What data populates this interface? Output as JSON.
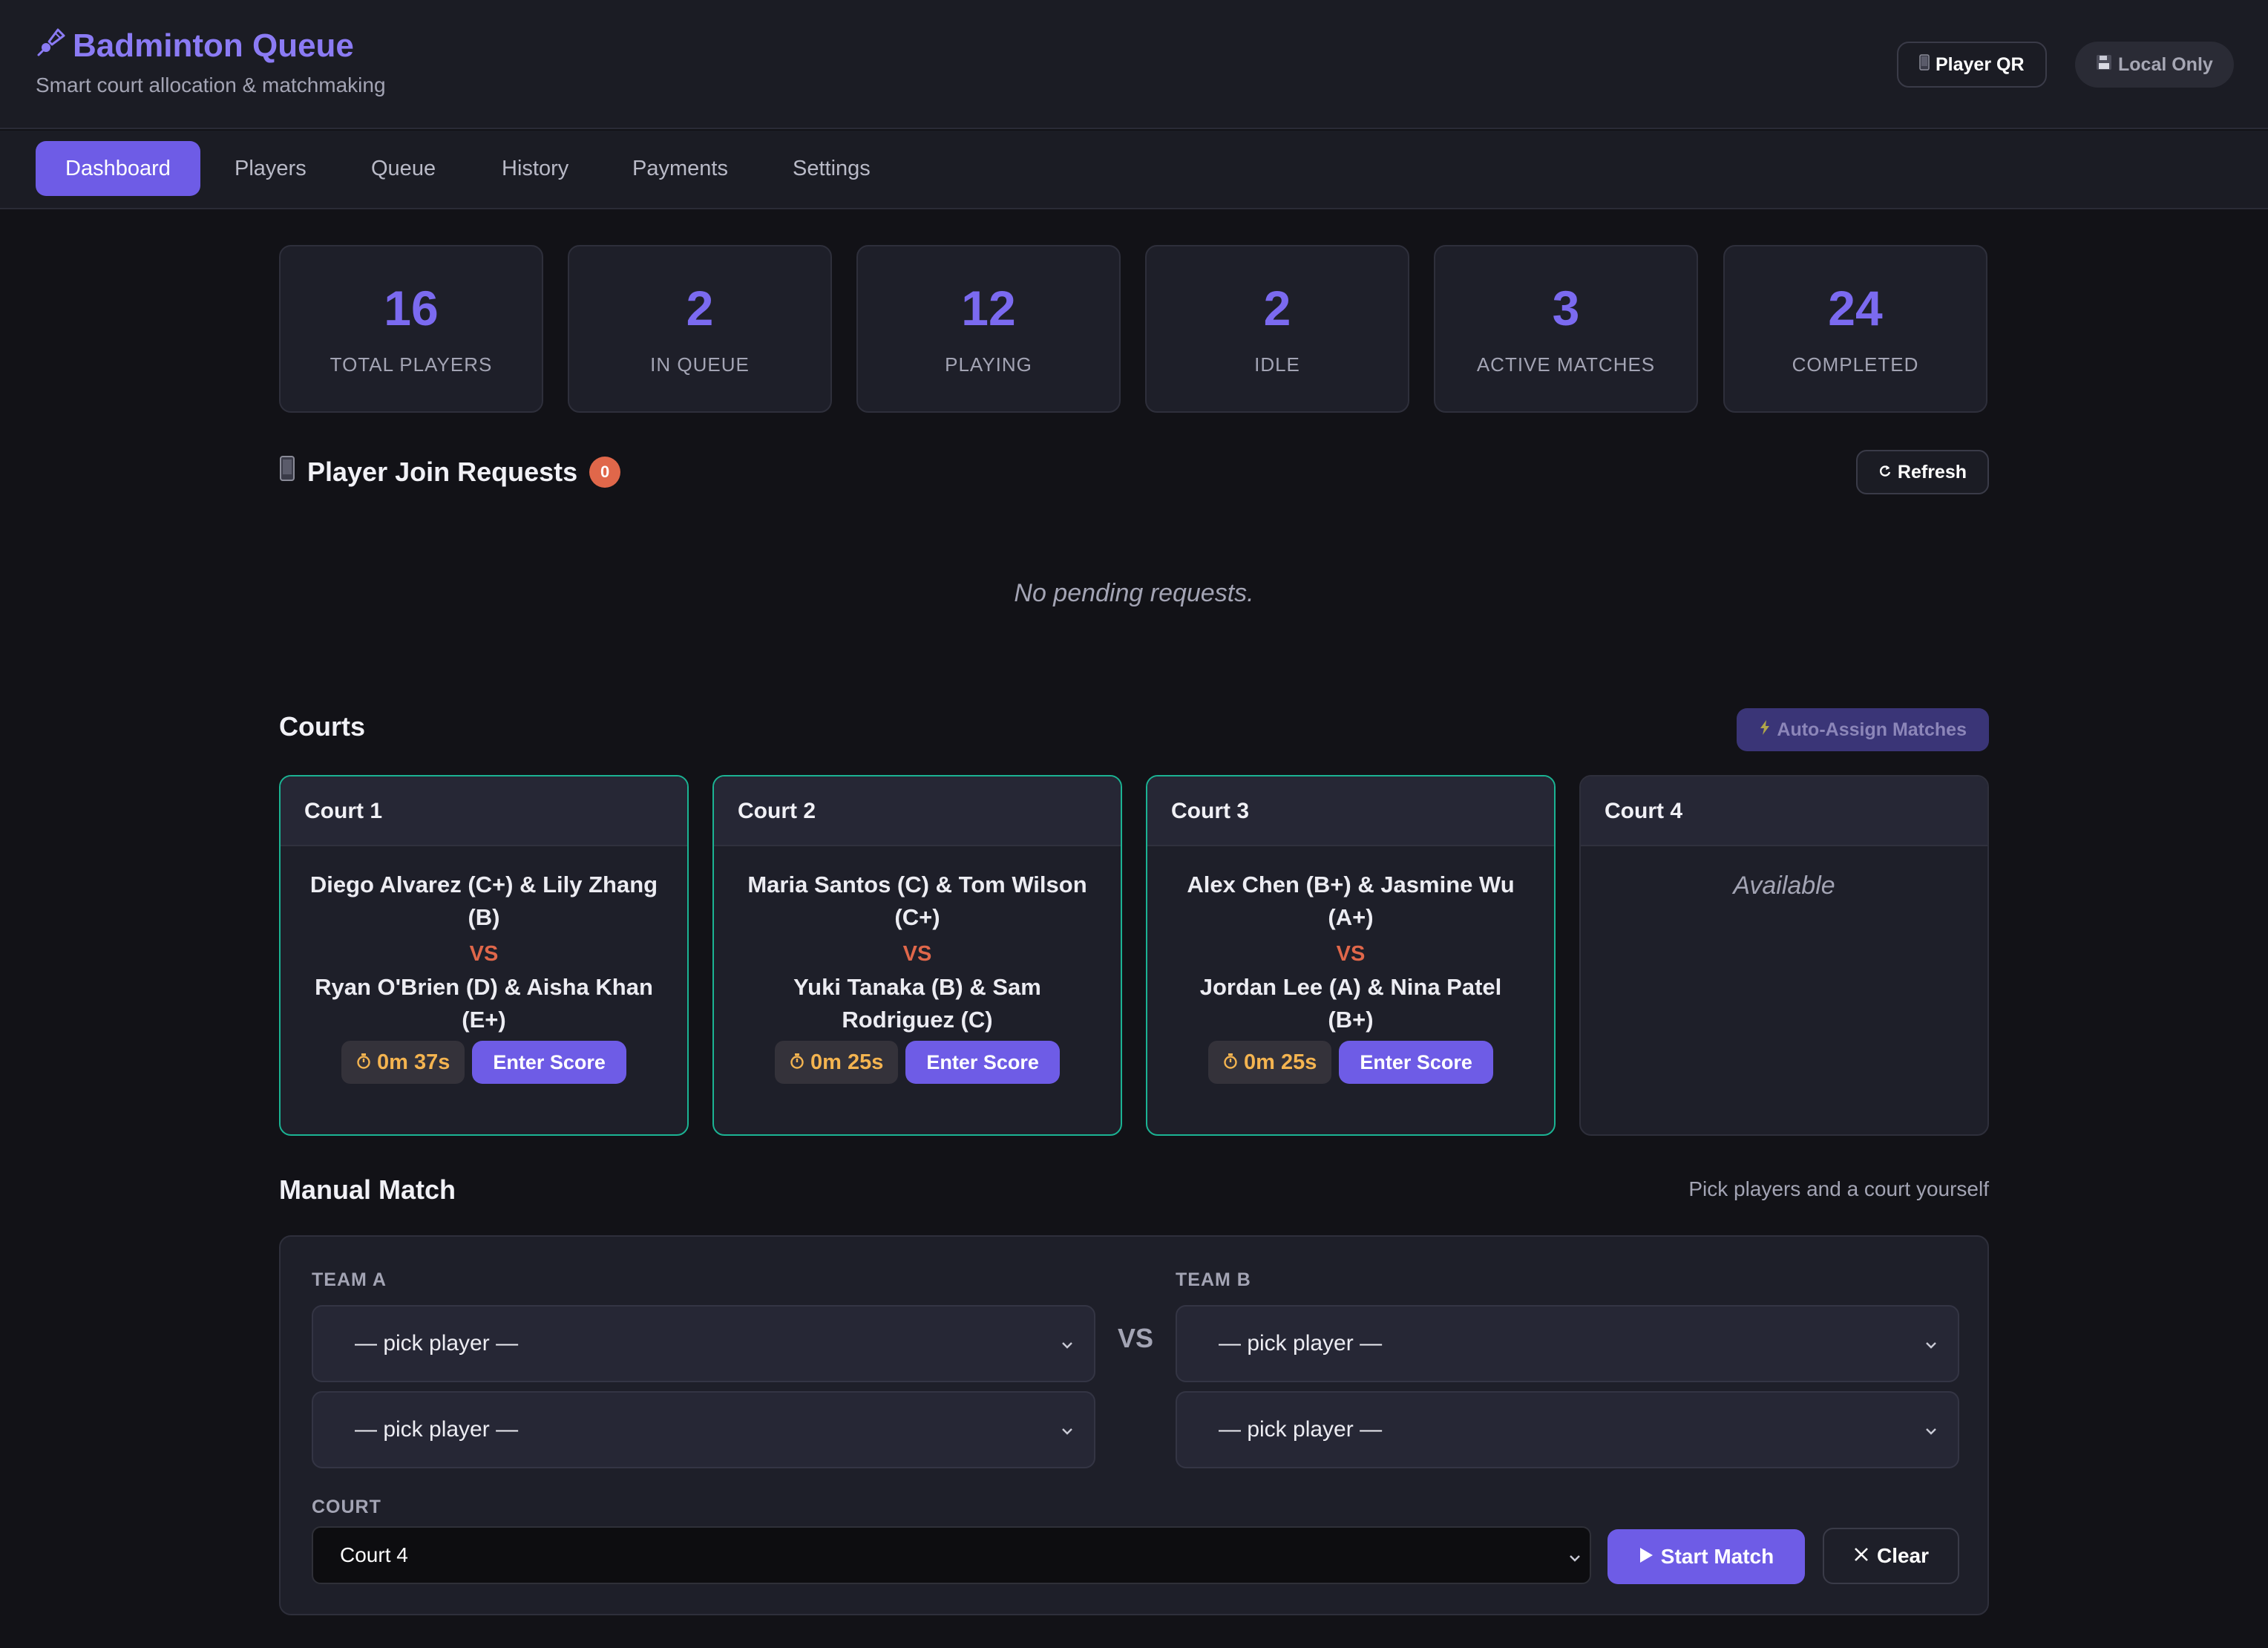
{
  "header": {
    "title": "Badminton Queue",
    "subtitle": "Smart court allocation & matchmaking",
    "logo_icon": "shuttlecock-icon",
    "qr_button": "Player QR",
    "local_badge": "Local Only"
  },
  "nav": {
    "tabs": [
      {
        "label": "Dashboard",
        "active": true
      },
      {
        "label": "Players",
        "active": false
      },
      {
        "label": "Queue",
        "active": false
      },
      {
        "label": "History",
        "active": false
      },
      {
        "label": "Payments",
        "active": false
      },
      {
        "label": "Settings",
        "active": false
      }
    ]
  },
  "stats": [
    {
      "value": "16",
      "label": "TOTAL PLAYERS"
    },
    {
      "value": "2",
      "label": "IN QUEUE"
    },
    {
      "value": "12",
      "label": "PLAYING"
    },
    {
      "value": "2",
      "label": "IDLE"
    },
    {
      "value": "3",
      "label": "ACTIVE MATCHES"
    },
    {
      "value": "24",
      "label": "COMPLETED"
    }
  ],
  "join_requests": {
    "title": "Player Join Requests",
    "count": "0",
    "refresh_label": "Refresh",
    "empty_text": "No pending requests."
  },
  "courts_section": {
    "title": "Courts",
    "auto_assign_label": "Auto-Assign Matches",
    "vs_label": "VS",
    "enter_score_label": "Enter Score",
    "courts": [
      {
        "name": "Court 1",
        "team_a": "Diego Alvarez (C+) & Lily Zhang (B)",
        "team_b": "Ryan O'Brien (D) & Aisha Khan (E+)",
        "timer": "0m 37s"
      },
      {
        "name": "Court 2",
        "team_a": "Maria Santos (C) & Tom Wilson (C+)",
        "team_b": "Yuki Tanaka (B) & Sam Rodriguez (C)",
        "timer": "0m 25s"
      },
      {
        "name": "Court 3",
        "team_a": "Alex Chen (B+) & Jasmine Wu (A+)",
        "team_b": "Jordan Lee (A) & Nina Patel (B+)",
        "timer": "0m 25s"
      },
      {
        "name": "Court 4",
        "status": "Available"
      }
    ]
  },
  "manual_match": {
    "title": "Manual Match",
    "hint": "Pick players and a court yourself",
    "team_a_label": "TEAM A",
    "team_b_label": "TEAM B",
    "vs_label": "VS",
    "pick_placeholder": "— pick player —",
    "court_label": "COURT",
    "court_value": "Court 4",
    "start_label": "Start Match",
    "clear_label": "Clear"
  },
  "colors": {
    "accent": "#6e5ce6",
    "accent_text": "#8b7bf4",
    "occupied_border": "#1bb393",
    "vs_color": "#e0674a",
    "timer_color": "#f4b450",
    "background": "#121217"
  }
}
